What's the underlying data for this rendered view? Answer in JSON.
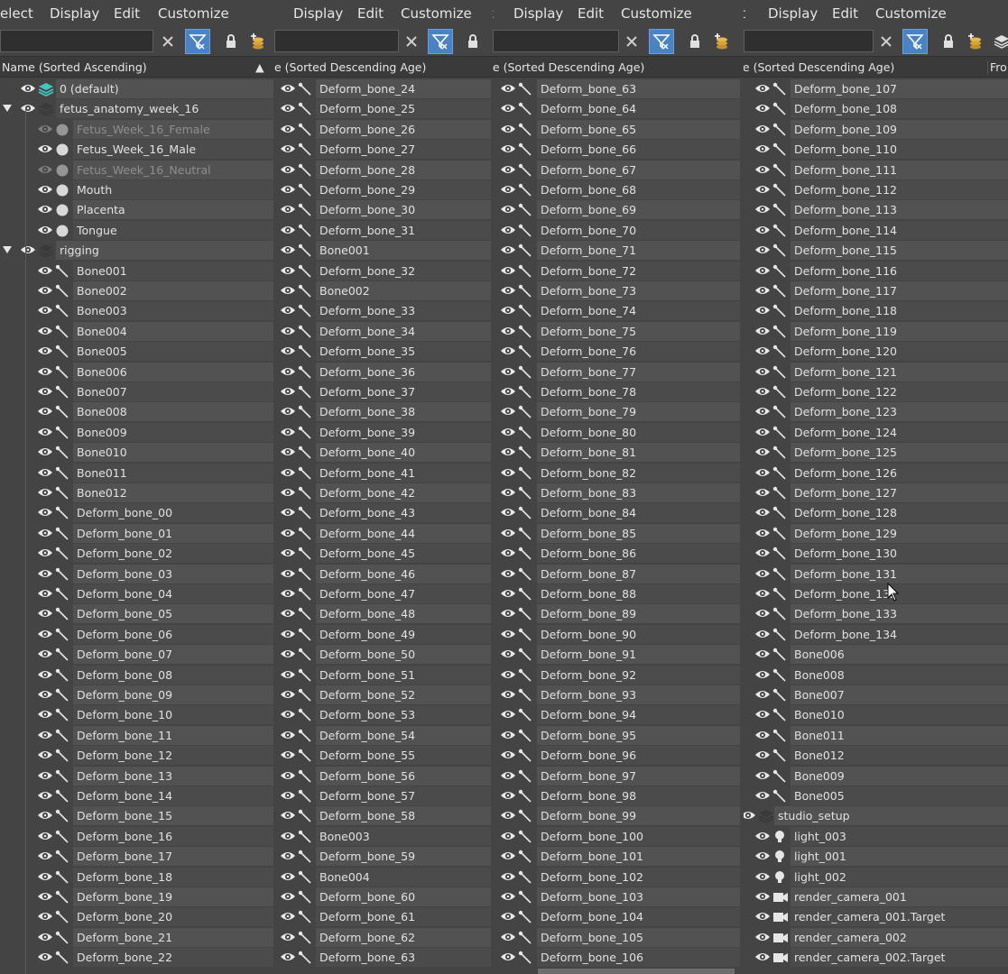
{
  "menus": [
    "elect",
    "Display",
    "Edit",
    "Customize"
  ],
  "menus2": [
    "Display",
    "Edit",
    "Customize"
  ],
  "menus3_prefix": "t",
  "menus4_prefix": "ct",
  "header1": "Name (Sorted Ascending)",
  "header2": "e (Sorted Descending Age)",
  "header3": "ne (Sorted Descending Age)",
  "header4": "ne (Sorted Descending Age)",
  "header4_extra": "Fro",
  "panel1_rows": [
    {
      "label": "0 (default)",
      "icon": "layer-default",
      "indent": 1
    },
    {
      "label": "fetus_anatomy_week_16",
      "icon": "layer",
      "indent": 0,
      "expand": true
    },
    {
      "label": "Fetus_Week_16_Female",
      "icon": "sphere",
      "indent": 2,
      "dim": true
    },
    {
      "label": "Fetus_Week_16_Male",
      "icon": "sphere",
      "indent": 2
    },
    {
      "label": "Fetus_Week_16_Neutral",
      "icon": "sphere",
      "indent": 2,
      "dim": true
    },
    {
      "label": "Mouth",
      "icon": "sphere",
      "indent": 2
    },
    {
      "label": "Placenta",
      "icon": "sphere",
      "indent": 2
    },
    {
      "label": "Tongue",
      "icon": "sphere",
      "indent": 2
    },
    {
      "label": "rigging",
      "icon": "layer",
      "indent": 0,
      "expand": true
    },
    {
      "label": "Bone001",
      "icon": "bone",
      "indent": 2
    },
    {
      "label": "Bone002",
      "icon": "bone",
      "indent": 2
    },
    {
      "label": "Bone003",
      "icon": "bone",
      "indent": 2
    },
    {
      "label": "Bone004",
      "icon": "bone",
      "indent": 2
    },
    {
      "label": "Bone005",
      "icon": "bone",
      "indent": 2
    },
    {
      "label": "Bone006",
      "icon": "bone",
      "indent": 2
    },
    {
      "label": "Bone007",
      "icon": "bone",
      "indent": 2
    },
    {
      "label": "Bone008",
      "icon": "bone",
      "indent": 2
    },
    {
      "label": "Bone009",
      "icon": "bone",
      "indent": 2
    },
    {
      "label": "Bone010",
      "icon": "bone",
      "indent": 2
    },
    {
      "label": "Bone011",
      "icon": "bone",
      "indent": 2
    },
    {
      "label": "Bone012",
      "icon": "bone",
      "indent": 2
    },
    {
      "label": "Deform_bone_00",
      "icon": "bone",
      "indent": 2
    },
    {
      "label": "Deform_bone_01",
      "icon": "bone",
      "indent": 2
    },
    {
      "label": "Deform_bone_02",
      "icon": "bone",
      "indent": 2
    },
    {
      "label": "Deform_bone_03",
      "icon": "bone",
      "indent": 2
    },
    {
      "label": "Deform_bone_04",
      "icon": "bone",
      "indent": 2
    },
    {
      "label": "Deform_bone_05",
      "icon": "bone",
      "indent": 2
    },
    {
      "label": "Deform_bone_06",
      "icon": "bone",
      "indent": 2
    },
    {
      "label": "Deform_bone_07",
      "icon": "bone",
      "indent": 2
    },
    {
      "label": "Deform_bone_08",
      "icon": "bone",
      "indent": 2
    },
    {
      "label": "Deform_bone_09",
      "icon": "bone",
      "indent": 2
    },
    {
      "label": "Deform_bone_10",
      "icon": "bone",
      "indent": 2
    },
    {
      "label": "Deform_bone_11",
      "icon": "bone",
      "indent": 2
    },
    {
      "label": "Deform_bone_12",
      "icon": "bone",
      "indent": 2
    },
    {
      "label": "Deform_bone_13",
      "icon": "bone",
      "indent": 2
    },
    {
      "label": "Deform_bone_14",
      "icon": "bone",
      "indent": 2
    },
    {
      "label": "Deform_bone_15",
      "icon": "bone",
      "indent": 2
    },
    {
      "label": "Deform_bone_16",
      "icon": "bone",
      "indent": 2
    },
    {
      "label": "Deform_bone_17",
      "icon": "bone",
      "indent": 2
    },
    {
      "label": "Deform_bone_18",
      "icon": "bone",
      "indent": 2
    },
    {
      "label": "Deform_bone_19",
      "icon": "bone",
      "indent": 2
    },
    {
      "label": "Deform_bone_20",
      "icon": "bone",
      "indent": 2
    },
    {
      "label": "Deform_bone_21",
      "icon": "bone",
      "indent": 2
    },
    {
      "label": "Deform_bone_22",
      "icon": "bone",
      "indent": 2
    }
  ],
  "panel2_rows": [
    "Deform_bone_24",
    "Deform_bone_25",
    "Deform_bone_26",
    "Deform_bone_27",
    "Deform_bone_28",
    "Deform_bone_29",
    "Deform_bone_30",
    "Deform_bone_31",
    "Bone001",
    "Deform_bone_32",
    "Bone002",
    "Deform_bone_33",
    "Deform_bone_34",
    "Deform_bone_35",
    "Deform_bone_36",
    "Deform_bone_37",
    "Deform_bone_38",
    "Deform_bone_39",
    "Deform_bone_40",
    "Deform_bone_41",
    "Deform_bone_42",
    "Deform_bone_43",
    "Deform_bone_44",
    "Deform_bone_45",
    "Deform_bone_46",
    "Deform_bone_47",
    "Deform_bone_48",
    "Deform_bone_49",
    "Deform_bone_50",
    "Deform_bone_51",
    "Deform_bone_52",
    "Deform_bone_53",
    "Deform_bone_54",
    "Deform_bone_55",
    "Deform_bone_56",
    "Deform_bone_57",
    "Deform_bone_58",
    "Bone003",
    "Deform_bone_59",
    "Bone004",
    "Deform_bone_60",
    "Deform_bone_61",
    "Deform_bone_62",
    "Deform_bone_63"
  ],
  "panel2_selected": "Deform_bone_63",
  "panel3_rows": [
    "Deform_bone_63",
    "Deform_bone_64",
    "Deform_bone_65",
    "Deform_bone_66",
    "Deform_bone_67",
    "Deform_bone_68",
    "Deform_bone_69",
    "Deform_bone_70",
    "Deform_bone_71",
    "Deform_bone_72",
    "Deform_bone_73",
    "Deform_bone_74",
    "Deform_bone_75",
    "Deform_bone_76",
    "Deform_bone_77",
    "Deform_bone_78",
    "Deform_bone_79",
    "Deform_bone_80",
    "Deform_bone_81",
    "Deform_bone_82",
    "Deform_bone_83",
    "Deform_bone_84",
    "Deform_bone_85",
    "Deform_bone_86",
    "Deform_bone_87",
    "Deform_bone_88",
    "Deform_bone_89",
    "Deform_bone_90",
    "Deform_bone_91",
    "Deform_bone_92",
    "Deform_bone_93",
    "Deform_bone_94",
    "Deform_bone_95",
    "Deform_bone_96",
    "Deform_bone_97",
    "Deform_bone_98",
    "Deform_bone_99",
    "Deform_bone_100",
    "Deform_bone_101",
    "Deform_bone_102",
    "Deform_bone_103",
    "Deform_bone_104",
    "Deform_bone_105",
    "Deform_bone_106"
  ],
  "panel4_rows": [
    {
      "label": "Deform_bone_107",
      "icon": "bone"
    },
    {
      "label": "Deform_bone_108",
      "icon": "bone"
    },
    {
      "label": "Deform_bone_109",
      "icon": "bone"
    },
    {
      "label": "Deform_bone_110",
      "icon": "bone"
    },
    {
      "label": "Deform_bone_111",
      "icon": "bone"
    },
    {
      "label": "Deform_bone_112",
      "icon": "bone"
    },
    {
      "label": "Deform_bone_113",
      "icon": "bone"
    },
    {
      "label": "Deform_bone_114",
      "icon": "bone"
    },
    {
      "label": "Deform_bone_115",
      "icon": "bone"
    },
    {
      "label": "Deform_bone_116",
      "icon": "bone"
    },
    {
      "label": "Deform_bone_117",
      "icon": "bone"
    },
    {
      "label": "Deform_bone_118",
      "icon": "bone"
    },
    {
      "label": "Deform_bone_119",
      "icon": "bone"
    },
    {
      "label": "Deform_bone_120",
      "icon": "bone"
    },
    {
      "label": "Deform_bone_121",
      "icon": "bone"
    },
    {
      "label": "Deform_bone_122",
      "icon": "bone"
    },
    {
      "label": "Deform_bone_123",
      "icon": "bone"
    },
    {
      "label": "Deform_bone_124",
      "icon": "bone"
    },
    {
      "label": "Deform_bone_125",
      "icon": "bone"
    },
    {
      "label": "Deform_bone_126",
      "icon": "bone"
    },
    {
      "label": "Deform_bone_127",
      "icon": "bone"
    },
    {
      "label": "Deform_bone_128",
      "icon": "bone"
    },
    {
      "label": "Deform_bone_129",
      "icon": "bone"
    },
    {
      "label": "Deform_bone_130",
      "icon": "bone"
    },
    {
      "label": "Deform_bone_131",
      "icon": "bone"
    },
    {
      "label": "Deform_bone_132",
      "icon": "bone"
    },
    {
      "label": "Deform_bone_133",
      "icon": "bone"
    },
    {
      "label": "Deform_bone_134",
      "icon": "bone"
    },
    {
      "label": "Bone006",
      "icon": "bone"
    },
    {
      "label": "Bone008",
      "icon": "bone"
    },
    {
      "label": "Bone007",
      "icon": "bone"
    },
    {
      "label": "Bone010",
      "icon": "bone"
    },
    {
      "label": "Bone011",
      "icon": "bone"
    },
    {
      "label": "Bone012",
      "icon": "bone"
    },
    {
      "label": "Bone009",
      "icon": "bone"
    },
    {
      "label": "Bone005",
      "icon": "bone"
    },
    {
      "label": "studio_setup",
      "icon": "layer",
      "layer": true
    },
    {
      "label": "light_003",
      "icon": "light"
    },
    {
      "label": "light_001",
      "icon": "light"
    },
    {
      "label": "light_002",
      "icon": "light"
    },
    {
      "label": "render_camera_001",
      "icon": "camera"
    },
    {
      "label": "render_camera_001.Target",
      "icon": "camera"
    },
    {
      "label": "render_camera_002",
      "icon": "camera"
    },
    {
      "label": "render_camera_002.Target",
      "icon": "camera"
    }
  ],
  "colors": {
    "filter_active": "#4a82c4",
    "layer_default": "#3ec8c0",
    "selected_row": "#707070"
  }
}
